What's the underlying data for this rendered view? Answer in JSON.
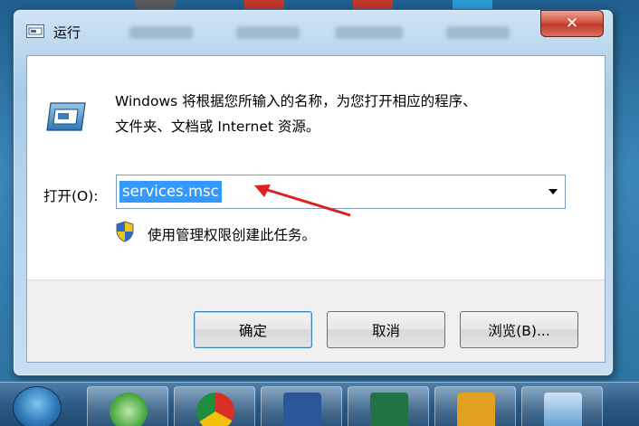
{
  "window": {
    "title": "运行",
    "close_label": "✕"
  },
  "dialog": {
    "description_line1": "Windows 将根据您所输入的名称，为您打开相应的程序、",
    "description_line2": "文件夹、文档或 Internet 资源。",
    "open_label": "打开(O):",
    "open_value": "services.msc",
    "admin_note": "使用管理权限创建此任务。"
  },
  "buttons": {
    "ok": "确定",
    "cancel": "取消",
    "browse": "浏览(B)..."
  },
  "taskbar": {
    "icons": [
      "start-icon",
      "ie-icon",
      "chrome-icon",
      "word-icon",
      "excel-icon",
      "app-icon",
      "run-icon"
    ]
  },
  "colors": {
    "selection": "#3399ff",
    "annotation_arrow": "#e02020",
    "close_button": "#c0392b"
  }
}
